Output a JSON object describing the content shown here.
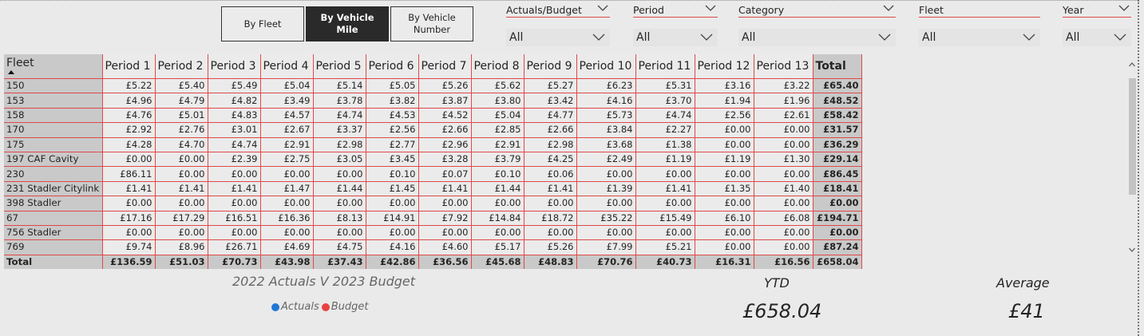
{
  "view_buttons": [
    {
      "label": "By Fleet",
      "active": false
    },
    {
      "label": "By Vehicle Mile",
      "active": true
    },
    {
      "label": "By Vehicle Number",
      "active": false
    }
  ],
  "slicers": [
    {
      "title": "Actuals/Budget",
      "value": "All"
    },
    {
      "title": "Period",
      "value": "All"
    },
    {
      "title": "Category",
      "value": "All"
    },
    {
      "title": "Fleet",
      "value": "All"
    },
    {
      "title": "Year",
      "value": "All"
    }
  ],
  "table": {
    "columns": [
      "Fleet",
      "Period 1",
      "Period 2",
      "Period 3",
      "Period 4",
      "Period 5",
      "Period 6",
      "Period 7",
      "Period 8",
      "Period 9",
      "Period 10",
      "Period 11",
      "Period 12",
      "Period 13",
      "Total"
    ],
    "rows": [
      [
        "150",
        "£5.22",
        "£5.40",
        "£5.49",
        "£5.04",
        "£5.14",
        "£5.05",
        "£5.26",
        "£5.62",
        "£5.27",
        "£6.23",
        "£5.31",
        "£3.16",
        "£3.22",
        "£65.40"
      ],
      [
        "153",
        "£4.96",
        "£4.79",
        "£4.82",
        "£3.49",
        "£3.78",
        "£3.82",
        "£3.87",
        "£3.80",
        "£3.42",
        "£4.16",
        "£3.70",
        "£1.94",
        "£1.96",
        "£48.52"
      ],
      [
        "158",
        "£4.76",
        "£5.01",
        "£4.83",
        "£4.57",
        "£4.74",
        "£4.53",
        "£4.52",
        "£5.04",
        "£4.77",
        "£5.73",
        "£4.74",
        "£2.56",
        "£2.61",
        "£58.42"
      ],
      [
        "170",
        "£2.92",
        "£2.76",
        "£3.01",
        "£2.67",
        "£3.37",
        "£2.56",
        "£2.66",
        "£2.85",
        "£2.66",
        "£3.84",
        "£2.27",
        "£0.00",
        "£0.00",
        "£31.57"
      ],
      [
        "175",
        "£4.28",
        "£4.70",
        "£4.74",
        "£2.91",
        "£2.98",
        "£2.77",
        "£2.96",
        "£2.91",
        "£2.98",
        "£3.68",
        "£1.38",
        "£0.00",
        "£0.00",
        "£36.29"
      ],
      [
        "197 CAF Cavity",
        "£0.00",
        "£0.00",
        "£2.39",
        "£2.75",
        "£3.05",
        "£3.45",
        "£3.28",
        "£3.79",
        "£4.25",
        "£2.49",
        "£1.19",
        "£1.19",
        "£1.30",
        "£29.14"
      ],
      [
        "230",
        "£86.11",
        "£0.00",
        "£0.00",
        "£0.00",
        "£0.00",
        "£0.10",
        "£0.07",
        "£0.10",
        "£0.06",
        "£0.00",
        "£0.00",
        "£0.00",
        "£0.00",
        "£86.45"
      ],
      [
        "231 Stadler Citylink",
        "£1.41",
        "£1.41",
        "£1.41",
        "£1.47",
        "£1.44",
        "£1.45",
        "£1.41",
        "£1.44",
        "£1.41",
        "£1.39",
        "£1.41",
        "£1.35",
        "£1.40",
        "£18.41"
      ],
      [
        "398 Stadler",
        "£0.00",
        "£0.00",
        "£0.00",
        "£0.00",
        "£0.00",
        "£0.00",
        "£0.00",
        "£0.00",
        "£0.00",
        "£0.00",
        "£0.00",
        "£0.00",
        "£0.00",
        "£0.00"
      ],
      [
        "67",
        "£17.16",
        "£17.29",
        "£16.51",
        "£16.36",
        "£8.13",
        "£14.91",
        "£7.92",
        "£14.84",
        "£18.72",
        "£35.22",
        "£15.49",
        "£6.10",
        "£6.08",
        "£194.71"
      ],
      [
        "756 Stadler",
        "£0.00",
        "£0.00",
        "£0.00",
        "£0.00",
        "£0.00",
        "£0.00",
        "£0.00",
        "£0.00",
        "£0.00",
        "£0.00",
        "£0.00",
        "£0.00",
        "£0.00",
        "£0.00"
      ],
      [
        "769",
        "£9.74",
        "£8.96",
        "£26.71",
        "£4.69",
        "£4.75",
        "£4.16",
        "£4.60",
        "£5.17",
        "£5.26",
        "£7.99",
        "£5.21",
        "£0.00",
        "£0.00",
        "£87.24"
      ]
    ],
    "total_row": [
      "Total",
      "£136.59",
      "£51.03",
      "£70.73",
      "£43.98",
      "£37.43",
      "£42.86",
      "£36.56",
      "£45.68",
      "£48.83",
      "£70.76",
      "£40.73",
      "£16.31",
      "£16.56",
      "£658.04"
    ]
  },
  "chart": {
    "title": "2022 Actuals V 2023 Budget",
    "legend": [
      {
        "label": "Actuals",
        "color": "#1f77d4"
      },
      {
        "label": "Budget",
        "color": "#e8433f"
      }
    ]
  },
  "cards": {
    "ytd_label": "YTD",
    "ytd_value": "£658.04",
    "average_label": "Average",
    "average_value": "£41"
  },
  "colors": {
    "accent": "#e04848",
    "active_button": "#2a2a2a"
  }
}
